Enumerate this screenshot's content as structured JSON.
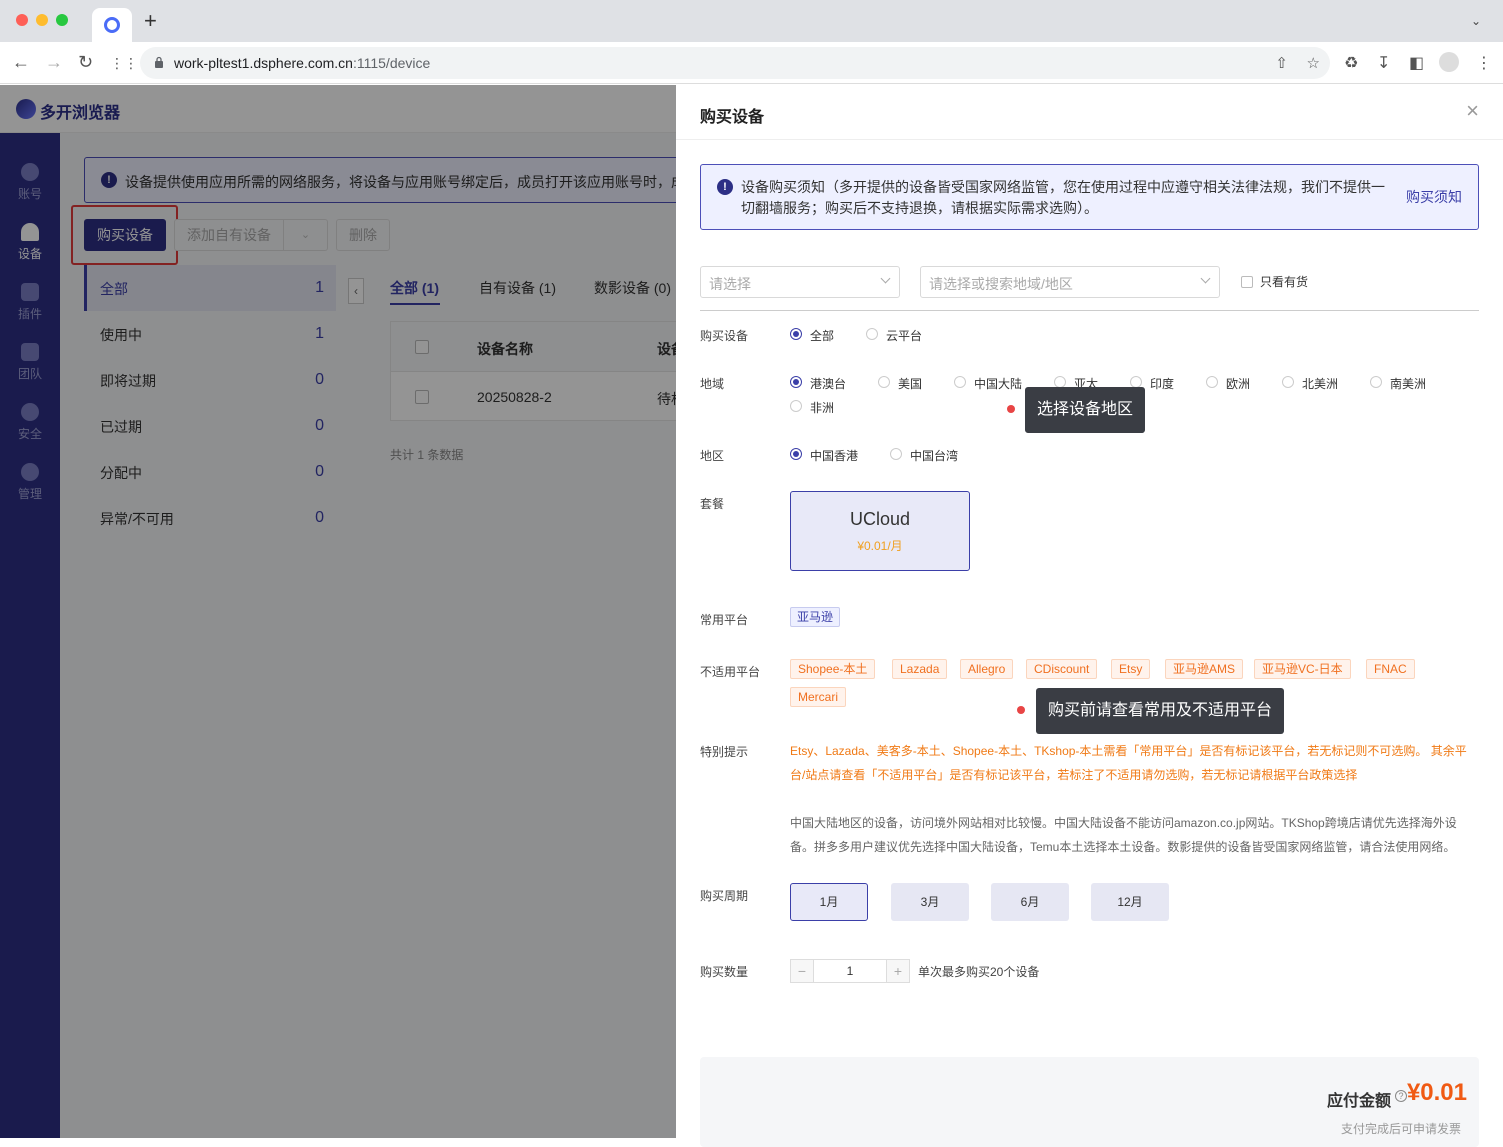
{
  "browser": {
    "url_main": "work-pltest1.dsphere.com.cn",
    "url_rest": ":1115/device"
  },
  "app": {
    "name": "多开浏览器"
  },
  "sidebar": {
    "items": [
      {
        "label": "账号"
      },
      {
        "label": "设备"
      },
      {
        "label": "插件"
      },
      {
        "label": "团队"
      },
      {
        "label": "安全"
      },
      {
        "label": "管理"
      }
    ]
  },
  "main": {
    "notice": "设备提供使用应用所需的网络服务，将设备与应用账号绑定后，成员打开该应用账号时，成",
    "toolbar": {
      "buy_label": "购买设备",
      "add_own_label": "添加自有设备",
      "delete_label": "删除"
    },
    "filters": [
      {
        "label": "全部",
        "count": "1"
      },
      {
        "label": "使用中",
        "count": "1"
      },
      {
        "label": "即将过期",
        "count": "0"
      },
      {
        "label": "已过期",
        "count": "0"
      },
      {
        "label": "分配中",
        "count": "0"
      },
      {
        "label": "异常/不可用",
        "count": "0"
      }
    ],
    "tabs": [
      {
        "label": "全部 (1)"
      },
      {
        "label": "自有设备 (1)"
      },
      {
        "label": "数影设备 (0)"
      }
    ],
    "table": {
      "col_name": "设备名称",
      "col_2": "设备",
      "row_name": "20250828-2",
      "row_col2": "待机"
    },
    "table_count": "共计 1 条数据"
  },
  "drawer": {
    "title": "购买设备",
    "notice": "设备购买须知（多开提供的设备皆受国家网络监管，您在使用过程中应遵守相关法律法规，我们不提供一切翻墙服务；购买后不支持退换，请根据实际需求选购）。",
    "notice_link": "购买须知",
    "select1_placeholder": "请选择",
    "select2_placeholder": "请选择或搜索地域/地区",
    "stock_only_label": "只看有货",
    "buy_device_label": "购买设备",
    "buy_device_options": [
      "全部",
      "云平台"
    ],
    "region_label": "地域",
    "region_options": [
      "港澳台",
      "美国",
      "中国大陆",
      "亚太",
      "印度",
      "欧洲",
      "北美洲",
      "南美洲",
      "非洲"
    ],
    "area_label": "地区",
    "area_options": [
      "中国香港",
      "中国台湾"
    ],
    "plan_label": "套餐",
    "plan_name": "UCloud",
    "plan_price": "¥0.01/月",
    "common_platform_label": "常用平台",
    "common_platforms": [
      "亚马逊"
    ],
    "unsupported_label": "不适用平台",
    "unsupported_platforms": [
      "Shopee-本土",
      "Lazada",
      "Allegro",
      "CDiscount",
      "Etsy",
      "亚马逊AMS",
      "亚马逊VC-日本",
      "FNAC",
      "Mercari"
    ],
    "special_label": "特别提示",
    "special_text": "Etsy、Lazada、美客多-本土、Shopee-本土、TKshop-本土需看「常用平台」是否有标记该平台，若无标记则不可选购。 其余平台/站点请查看「不适用平台」是否有标记该平台，若标注了不适用请勿选购，若无标记请根据平台政策选择",
    "info_text": "中国大陆地区的设备，访问境外网站相对比较慢。中国大陆设备不能访问amazon.co.jp网站。TKShop跨境店请优先选择海外设备。拼多多用户建议优先选择中国大陆设备，Temu本土选择本土设备。数影提供的设备皆受国家网络监管，请合法使用网络。",
    "period_label": "购买周期",
    "periods": [
      "1月",
      "3月",
      "6月",
      "12月"
    ],
    "qty_label": "购买数量",
    "qty_value": "1",
    "qty_note": "单次最多购买20个设备",
    "pay_label": "应付金额",
    "pay_amount": "¥0.01",
    "pay_note": "支付完成后可申请发票"
  },
  "tooltips": {
    "region_tip": "选择设备地区",
    "platform_tip": "购买前请查看常用及不适用平台"
  },
  "colors": {
    "brand": "#2d2f86",
    "accent": "#3b3fa8",
    "price": "#f05a14",
    "warning": "#f07a16",
    "highlight": "#e23c3c"
  }
}
